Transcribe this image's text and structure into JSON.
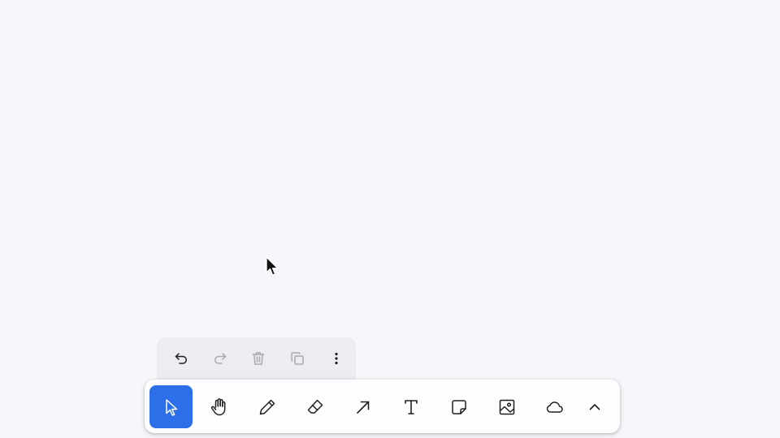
{
  "colors": {
    "canvas_background": "#f6f7fb",
    "active_tool": "#2d6fe8",
    "icon": "#1f1f1f",
    "icon_disabled": "#a9a9ad"
  },
  "action_bar": {
    "items": [
      {
        "icon": "undo-icon",
        "enabled": true
      },
      {
        "icon": "redo-icon",
        "enabled": false
      },
      {
        "icon": "trash-icon",
        "enabled": false
      },
      {
        "icon": "duplicate-icon",
        "enabled": false
      },
      {
        "icon": "more-vertical-icon",
        "enabled": true
      }
    ]
  },
  "toolbar": {
    "active_tool": "select",
    "tools": [
      {
        "id": "select",
        "icon": "pointer-icon"
      },
      {
        "id": "hand",
        "icon": "hand-icon"
      },
      {
        "id": "draw",
        "icon": "pencil-icon"
      },
      {
        "id": "eraser",
        "icon": "eraser-icon"
      },
      {
        "id": "arrow",
        "icon": "arrow-icon"
      },
      {
        "id": "text",
        "icon": "text-icon"
      },
      {
        "id": "note",
        "icon": "sticky-note-icon"
      },
      {
        "id": "media",
        "icon": "image-icon"
      },
      {
        "id": "geo",
        "icon": "cloud-icon"
      },
      {
        "id": "more",
        "icon": "chevron-up-icon"
      }
    ]
  }
}
